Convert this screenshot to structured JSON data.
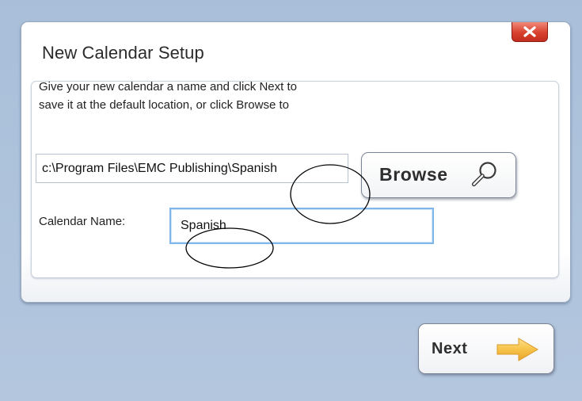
{
  "dialog": {
    "title": "New Calendar Setup",
    "close_icon": "close-icon",
    "instructions": {
      "line1": "Give your new calendar a name and click Next to",
      "line2": "save it at the default location, or click Browse to"
    },
    "path_field": {
      "value": "c:\\Program Files\\EMC Publishing\\Spanish"
    },
    "browse_button": {
      "label": "Browse",
      "icon": "magnifier-icon"
    },
    "calendar_name": {
      "label": "Calendar Name:",
      "value": "Spanish"
    }
  },
  "footer": {
    "next_button": {
      "label": "Next",
      "icon": "arrow-right-icon"
    }
  },
  "colors": {
    "background": "#b0c4de",
    "close_button": "#d9402e",
    "name_field_focus": "#7fb7ea",
    "next_arrow": "#f5b73a"
  }
}
